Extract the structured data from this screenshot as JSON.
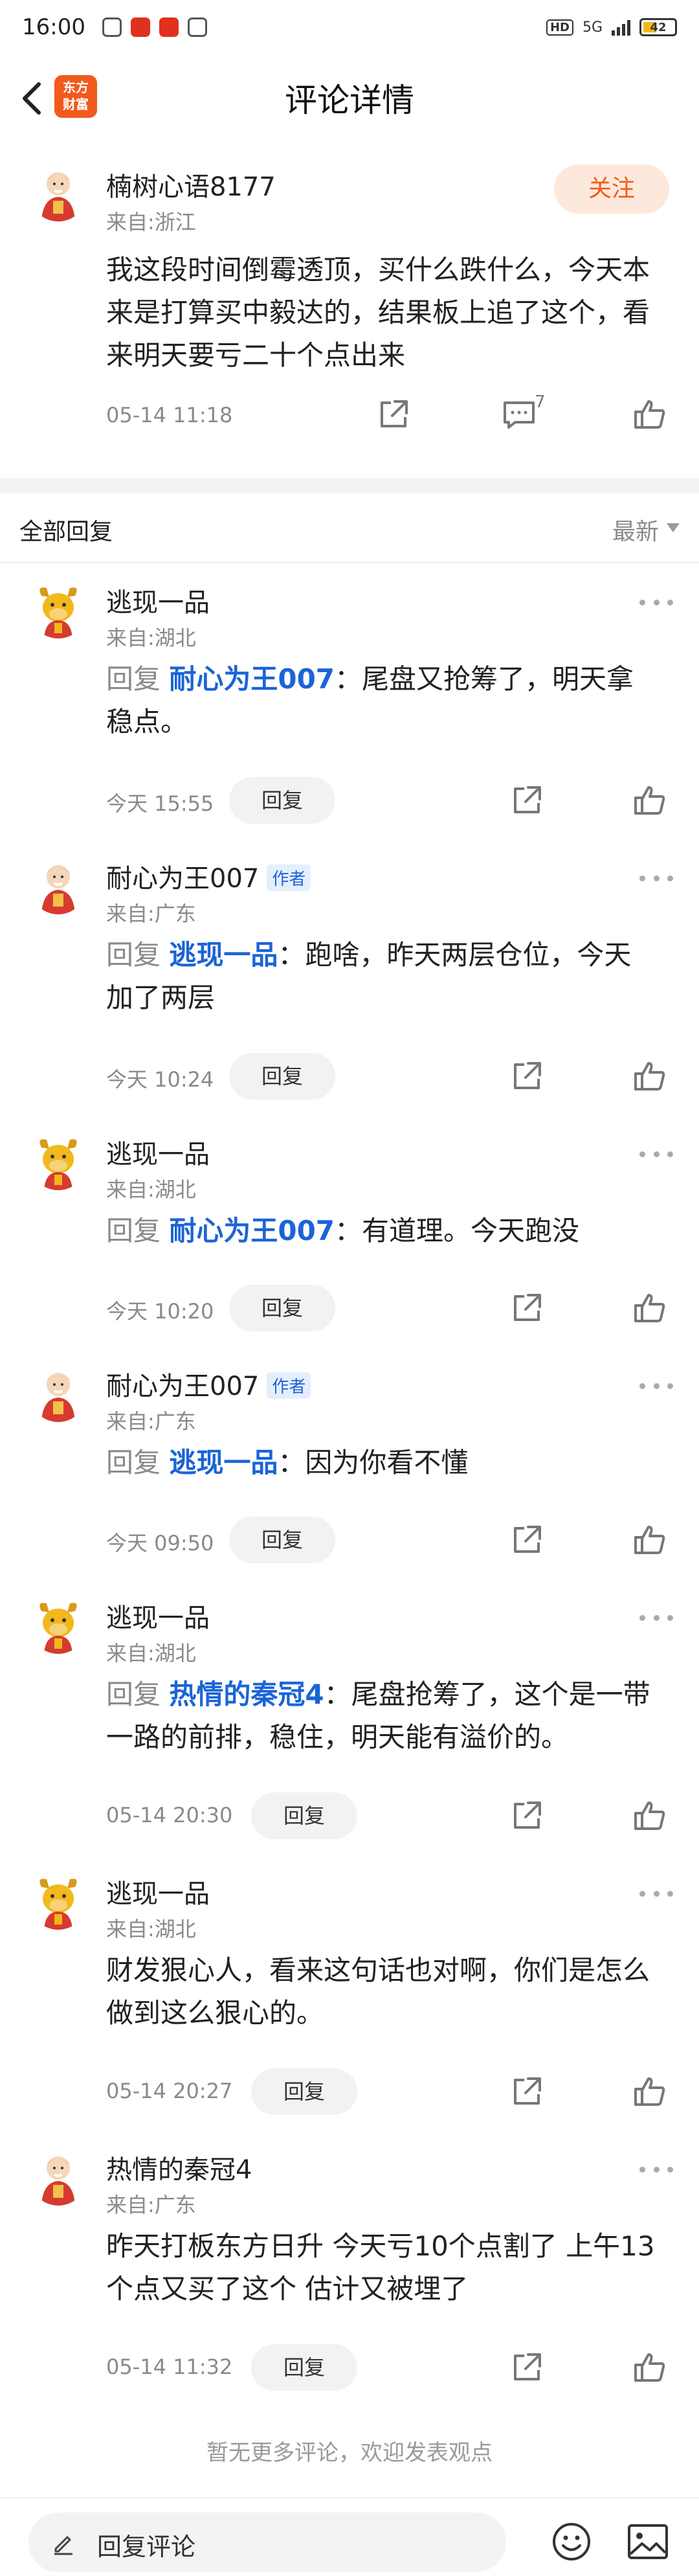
{
  "status_bar": {
    "time": "16:00",
    "network": "5G",
    "hd": "HD",
    "battery": "42"
  },
  "header": {
    "title": "评论详情",
    "logo_text": "东方\n财富"
  },
  "main_comment": {
    "user": "楠树心语8177",
    "location": "来自:浙江",
    "follow_label": "关注",
    "text": "我这段时间倒霉透顶，买什么跌什么，今天本来是打算买中毅达的，结果板上追了这个，看来明天要亏二十个点出来",
    "time": "05-14 11:18",
    "comment_count": "7"
  },
  "section": {
    "label": "全部回复",
    "sort": "最新"
  },
  "replies": [
    {
      "user": "逃现一品",
      "author": false,
      "location": "来自:湖北",
      "prefix": "回复 ",
      "mention": "耐心为王007",
      "text": "：尾盘又抢筹了，明天拿稳点。",
      "time": "今天 15:55",
      "reply_label": "回复"
    },
    {
      "user": "耐心为王007",
      "author": true,
      "author_label": "作者",
      "location": "来自:广东",
      "prefix": "回复 ",
      "mention": "逃现一品",
      "text": "：跑啥，昨天两层仓位，今天加了两层",
      "time": "今天 10:24",
      "reply_label": "回复"
    },
    {
      "user": "逃现一品",
      "author": false,
      "location": "来自:湖北",
      "prefix": "回复 ",
      "mention": "耐心为王007",
      "text": "：有道理。今天跑没",
      "time": "今天 10:20",
      "reply_label": "回复"
    },
    {
      "user": "耐心为王007",
      "author": true,
      "author_label": "作者",
      "location": "来自:广东",
      "prefix": "回复 ",
      "mention": "逃现一品",
      "text": "：因为你看不懂",
      "time": "今天 09:50",
      "reply_label": "回复"
    },
    {
      "user": "逃现一品",
      "author": false,
      "location": "来自:湖北",
      "prefix": "回复 ",
      "mention": "热情的秦冠4",
      "text": "：尾盘抢筹了，这个是一带一路的前排，稳住，明天能有溢价的。",
      "time": "05-14 20:30",
      "reply_label": "回复"
    },
    {
      "user": "逃现一品",
      "author": false,
      "location": "来自:湖北",
      "prefix": "",
      "mention": "",
      "text": "财发狠心人，看来这句话也对啊，你们是怎么做到这么狠心的。",
      "time": "05-14 20:27",
      "reply_label": "回复"
    },
    {
      "user": "热情的秦冠4",
      "author": false,
      "location": "来自:广东",
      "prefix": "",
      "mention": "",
      "text": "昨天打板东方日升 今天亏10个点割了  上午13个点又买了这个  估计又被埋了",
      "time": "05-14 11:32",
      "reply_label": "回复"
    }
  ],
  "footer_note": "暂无更多评论，欢迎发表观点",
  "bottom_bar": {
    "placeholder": "回复评论"
  },
  "colors": {
    "accent": "#f25a1d",
    "mention": "#1b64d6",
    "muted": "#8a8a8a"
  },
  "icons": [
    "back-arrow-icon",
    "share-icon",
    "comment-icon",
    "thumbs-up-icon",
    "more-icon",
    "pen-icon",
    "emoji-icon",
    "image-icon"
  ]
}
